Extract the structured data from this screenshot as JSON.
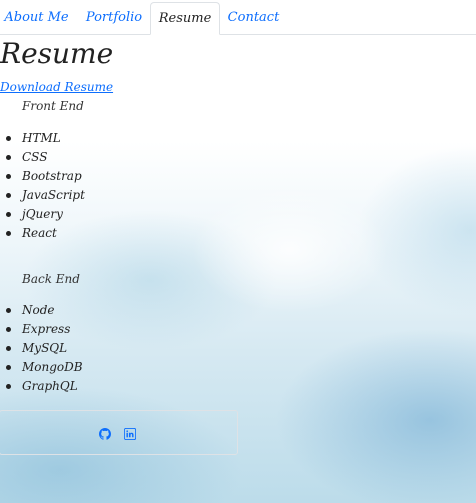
{
  "nav": {
    "tabs": [
      {
        "label": "About Me",
        "active": false
      },
      {
        "label": "Portfolio",
        "active": false
      },
      {
        "label": "Resume",
        "active": true
      },
      {
        "label": "Contact",
        "active": false
      }
    ]
  },
  "page": {
    "title": "Resume",
    "download_label": "Download Resume"
  },
  "front_end": {
    "heading": "Front End",
    "items": [
      "HTML",
      "CSS",
      "Bootstrap",
      "JavaScript",
      "jQuery",
      "React"
    ]
  },
  "back_end": {
    "heading": "Back End",
    "items": [
      "Node",
      "Express",
      "MySQL",
      "MongoDB",
      "GraphQL"
    ]
  },
  "footer": {
    "icons": [
      "github-icon",
      "linkedin-icon"
    ]
  },
  "colors": {
    "link": "#0d6efd",
    "text": "#222222",
    "border": "#dee2e6"
  }
}
